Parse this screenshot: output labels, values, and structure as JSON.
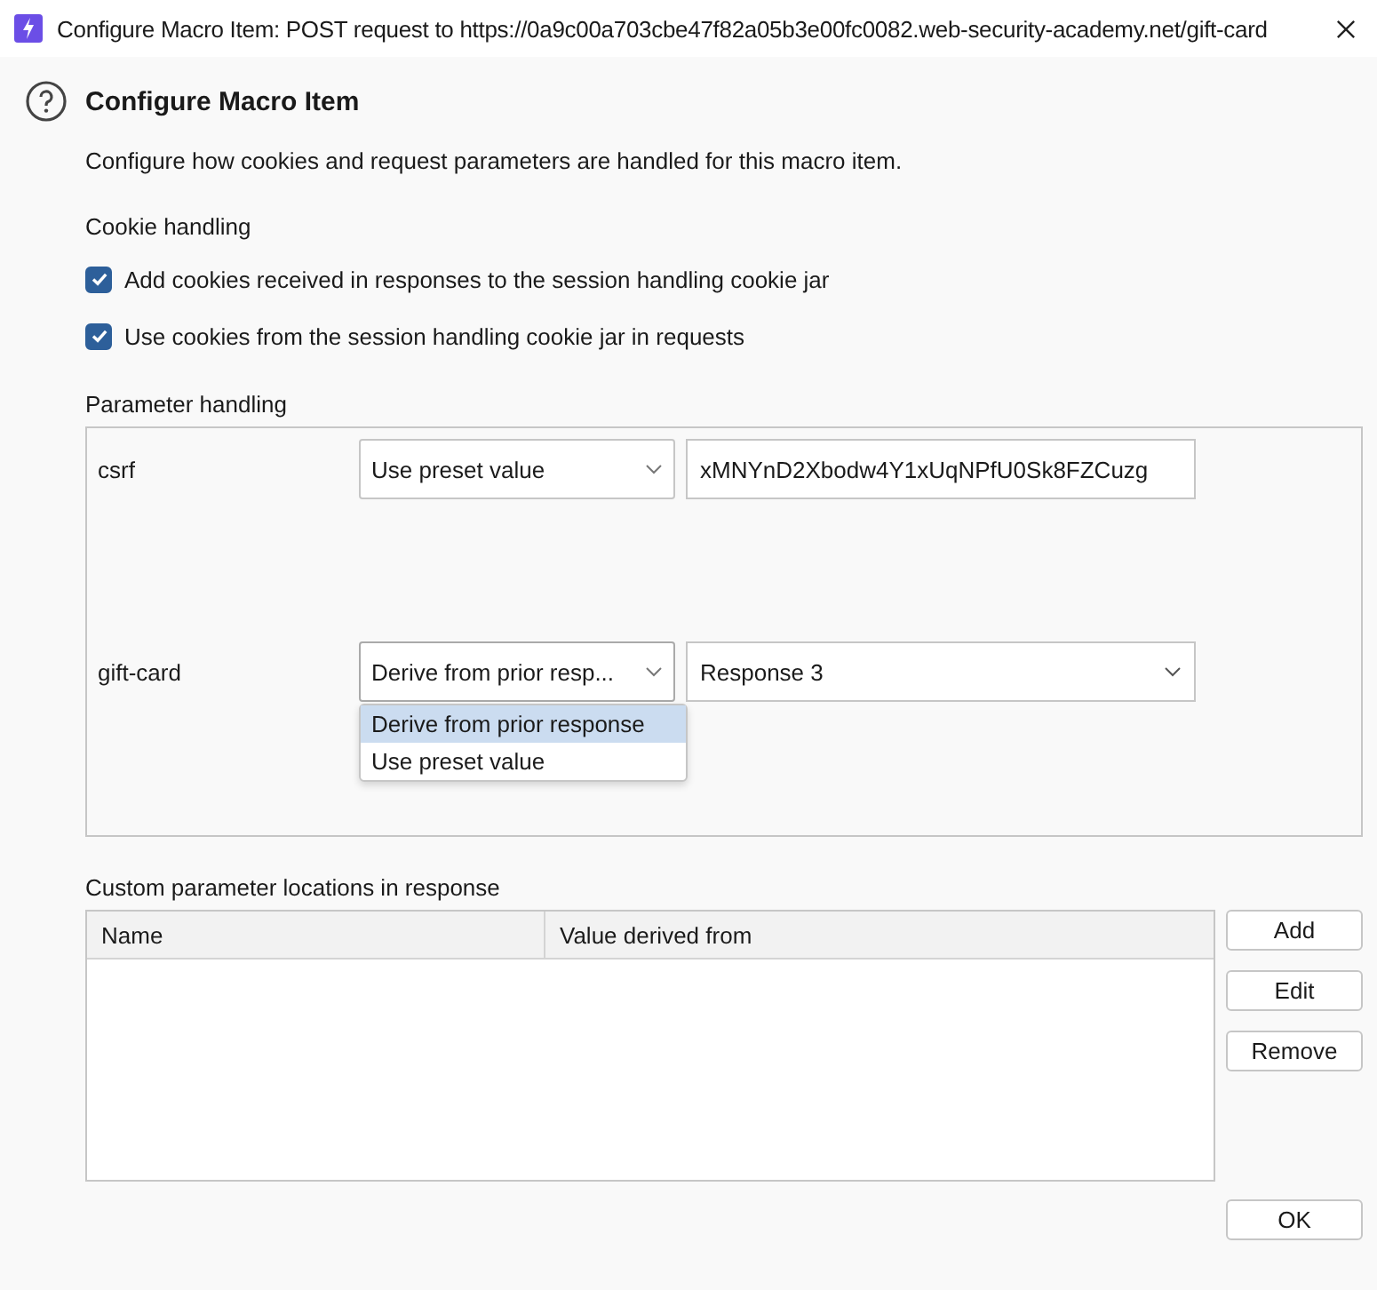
{
  "window": {
    "title": "Configure Macro Item: POST request to https://0a9c00a703cbe47f82a05b3e00fc0082.web-security-academy.net/gift-card"
  },
  "heading": "Configure Macro Item",
  "description": "Configure how cookies and request parameters are handled for this macro item.",
  "cookie_handling": {
    "label": "Cookie handling",
    "options": [
      {
        "label": "Add cookies received in responses to the session handling cookie jar",
        "checked": true
      },
      {
        "label": "Use cookies from the session handling cookie jar in requests",
        "checked": true
      }
    ]
  },
  "parameter_handling": {
    "label": "Parameter handling",
    "parameters": [
      {
        "kind": "preset",
        "name": "csrf",
        "mode": "Use preset value",
        "value": "xMNYnD2Xbodw4Y1xUqNPfU0Sk8FZCuzg",
        "expanded": false
      },
      {
        "kind": "derive",
        "name": "gift-card",
        "mode": "Derive from prior resp...",
        "value": "Response 3",
        "expanded": true,
        "options": [
          {
            "label": "Derive from prior response",
            "selected": true
          },
          {
            "label": "Use preset value",
            "selected": false
          }
        ]
      }
    ]
  },
  "custom_locations": {
    "label": "Custom parameter locations in response",
    "table": {
      "columns": [
        "Name",
        "Value derived from"
      ]
    },
    "buttons": [
      "Add",
      "Edit",
      "Remove"
    ]
  },
  "footer_buttons": [
    "OK"
  ]
}
